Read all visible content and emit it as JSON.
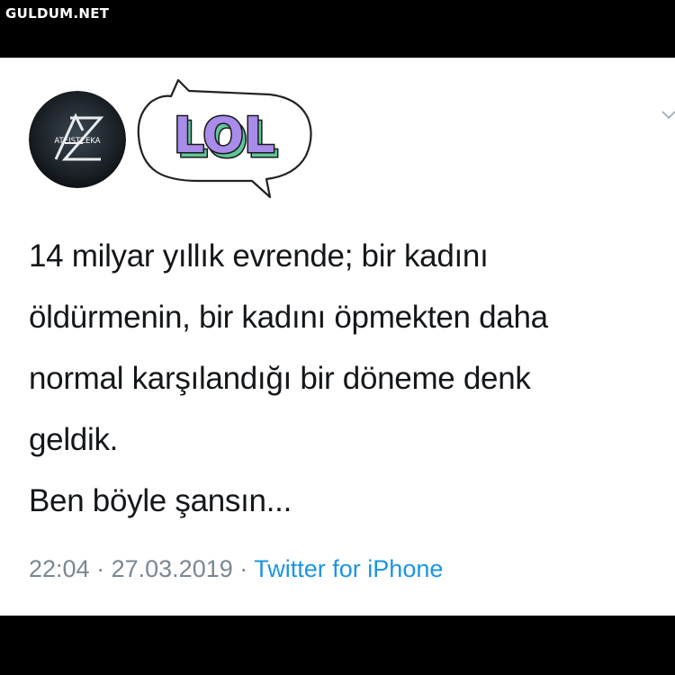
{
  "watermark": "GULDUM.NET",
  "profile": {
    "avatar_text": "ATEISTZEKA",
    "avatar_icon": "az-logo-icon",
    "sticker_text": "LOL"
  },
  "tweet": {
    "lines": [
      "14 milyar yıllık evrende; bir kadını",
      "öldürmenin, bir kadını öpmekten daha",
      "normal karşılandığı bir döneme denk",
      "geldik.",
      "Ben böyle şansın..."
    ],
    "time": "22:04",
    "separator": "·",
    "date": "27.03.2019",
    "source": "Twitter for iPhone"
  },
  "colors": {
    "text": "#14171a",
    "meta": "#7a8791",
    "link": "#1b95e0",
    "sticker_fill": "#a98bea",
    "sticker_shadow": "#5fc79a"
  }
}
